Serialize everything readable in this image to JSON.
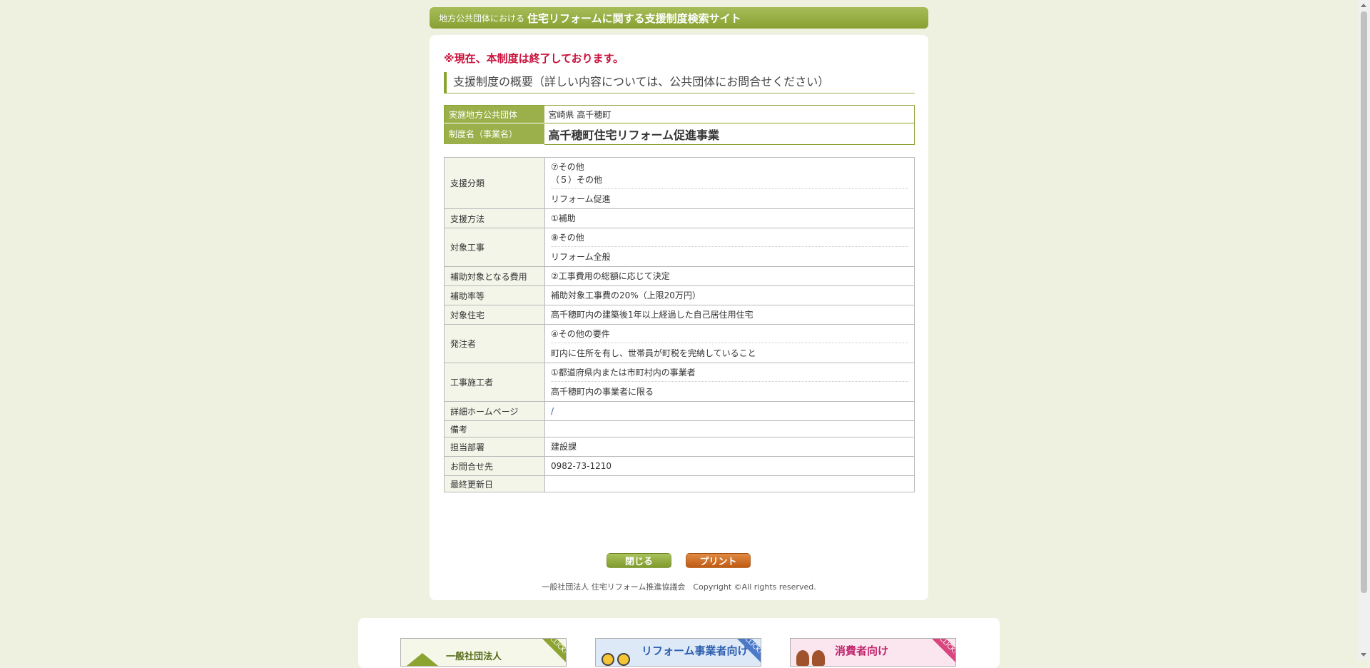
{
  "header": {
    "prefix": "地方公共団体における",
    "title": "住宅リフォームに関する支援制度検索サイト"
  },
  "notice": "※現在、本制度は終了しております。",
  "section_title": "支援制度の概要（詳しい内容については、公共団体にお問合せください）",
  "summary": {
    "rows": [
      {
        "label": "実施地方公共団体",
        "value": "宮崎県 高千穂町"
      },
      {
        "label": "制度名（事業名）",
        "value": "高千穂町住宅リフォーム促進事業"
      }
    ]
  },
  "detail": {
    "support_type": {
      "label": "支援分類",
      "line1": "⑦その他",
      "line2": "（５）その他",
      "line3": "リフォーム促進"
    },
    "support_method": {
      "label": "支援方法",
      "value": "①補助"
    },
    "target_work": {
      "label": "対象工事",
      "line1": "⑧その他",
      "line2": "リフォーム全般"
    },
    "cost": {
      "label": "補助対象となる費用",
      "value": "②工事費用の総額に応じて決定"
    },
    "rate": {
      "label": "補助率等",
      "value": "補助対象工事費の20%（上限20万円）"
    },
    "housing": {
      "label": "対象住宅",
      "value": "高千穂町内の建築後1年以上経過した自己居住用住宅"
    },
    "orderer": {
      "label": "発注者",
      "line1": "④その他の要件",
      "line2": "町内に住所を有し、世帯員が町税を完納していること"
    },
    "contractor": {
      "label": "工事施工者",
      "line1": "①都道府県内または市町村内の事業者",
      "line2": "高千穂町内の事業者に限る"
    },
    "homepage": {
      "label": "詳細ホームページ",
      "value": "/"
    },
    "notes": {
      "label": "備考",
      "value": ""
    },
    "department": {
      "label": "担当部署",
      "value": "建設課"
    },
    "contact": {
      "label": "お問合せ先",
      "value": "0982-73-1210"
    },
    "updated": {
      "label": "最終更新日",
      "value": ""
    }
  },
  "buttons": {
    "close": "閉じる",
    "print": "プリント"
  },
  "footer": "一般社団法人 住宅リフォーム推進協議会　Copyright ©All rights reserved.",
  "banners": [
    {
      "text": "一般社団法人",
      "corner": "CLICK!"
    },
    {
      "text": "リフォーム事業者向け",
      "corner": "CLICK!"
    },
    {
      "text": "消費者向け",
      "corner": "CLICK!"
    }
  ]
}
